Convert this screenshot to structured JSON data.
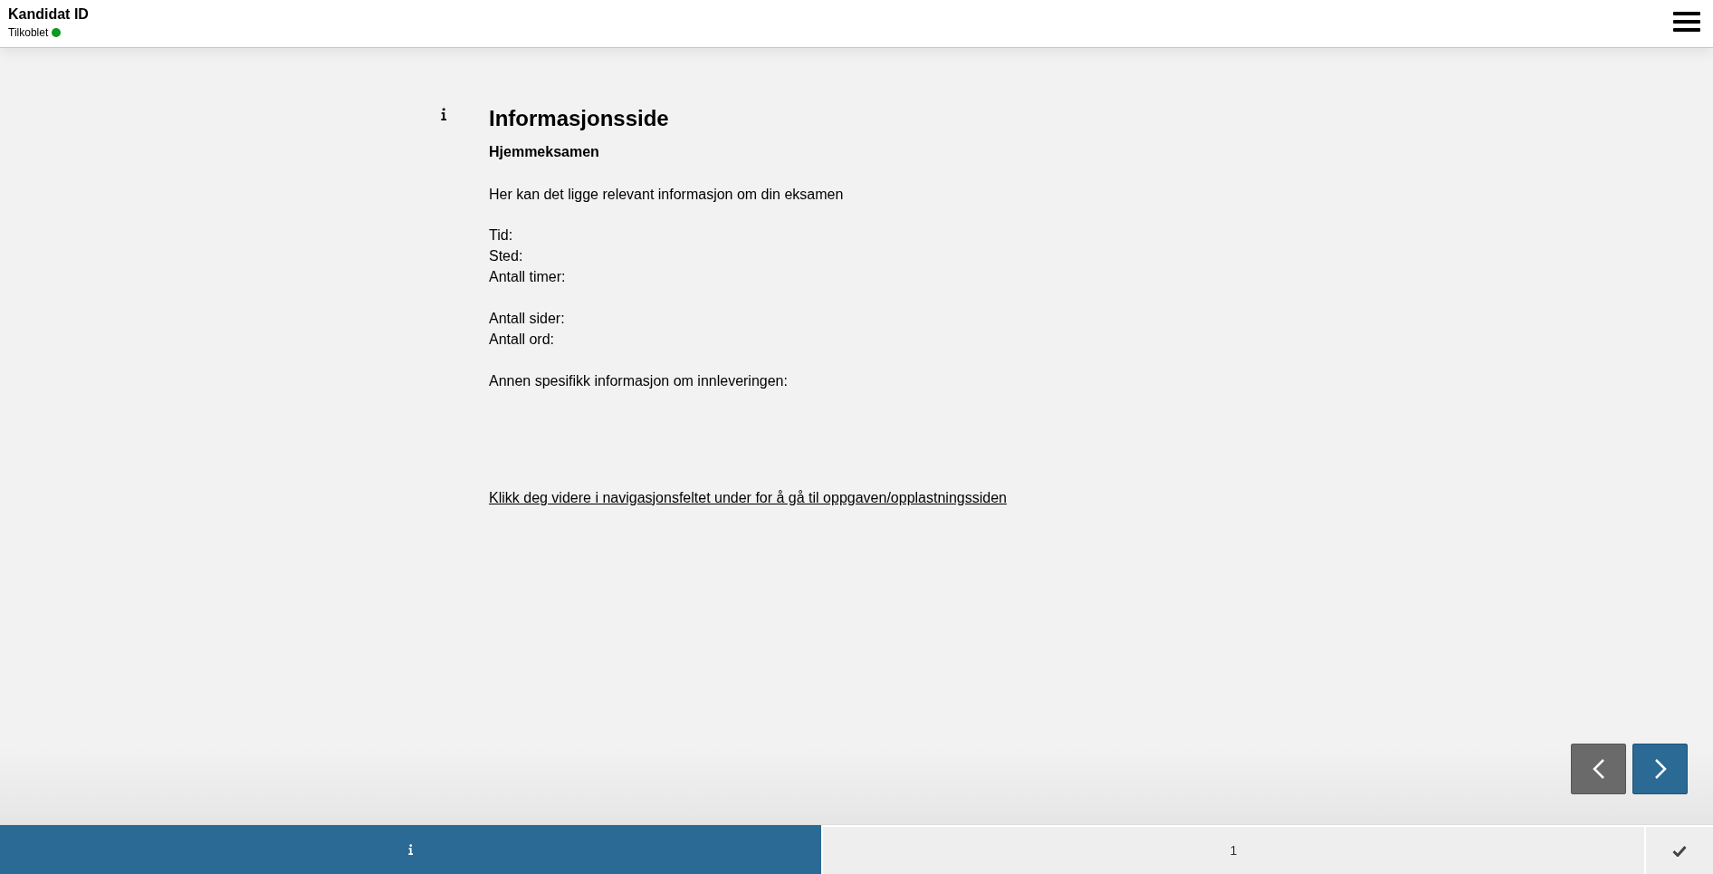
{
  "header": {
    "title": "Kandidat ID",
    "status": {
      "label": "Tilkoblet",
      "connected": true
    }
  },
  "content": {
    "title": "Informasjonsside",
    "subtitle": "Hjemmeksamen",
    "intro": "Her kan det ligge relevant informasjon om din eksamen",
    "groups": [
      [
        "Tid:",
        "Sted:",
        "Antall timer:"
      ],
      [
        "Antall sider:",
        "Antall ord:"
      ],
      [
        "Annen spesifikk informasjon om innleveringen:"
      ]
    ],
    "link": "Klikk deg videre i navigasjonsfeltet under for å gå til oppgaven/opplastningssiden"
  },
  "nav_buttons": [
    {
      "kind": "previous",
      "disabled": true
    },
    {
      "kind": "next",
      "disabled": false
    }
  ],
  "tabs": [
    {
      "kind": "info",
      "selected": true
    },
    {
      "kind": "page",
      "label": "1",
      "selected": false
    },
    {
      "kind": "finish",
      "selected": false
    }
  ]
}
